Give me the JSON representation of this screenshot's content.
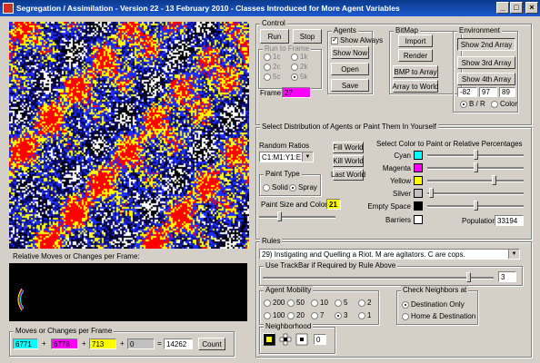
{
  "window": {
    "title": "Segregation / Assimilation - Version 22 - 13 February 2010 - Classes Introduced for More Agent Variables",
    "minimize": "_",
    "maximize": "□",
    "close": "×"
  },
  "left": {
    "moves_chart_label": "Relative Moves or Changes per Frame:",
    "moves_group_title": "Moves or Changes per Frame",
    "counts": [
      "6771",
      "6778",
      "713",
      "0"
    ],
    "plus": "+",
    "equals": "=",
    "total": "14262",
    "count_button": "Count",
    "colors": {
      "cyan": "#00ffff",
      "magenta": "#ff00ff",
      "yellow": "#ffff00",
      "silver": "#c0c0c0"
    }
  },
  "control": {
    "title": "Control",
    "run": "Run",
    "stop": "Stop",
    "run_to_frame_title": "Run to Frame",
    "run_options": [
      "1c",
      "2c",
      "5c",
      "1k",
      "2k",
      "5k"
    ],
    "frame_label": "Frame #",
    "frame_value": "27",
    "agents_title": "Agents",
    "show_always": "Show Always",
    "show_now": "Show Now",
    "open": "Open",
    "save": "Save",
    "bitmap_title": "BitMap",
    "import": "Import",
    "render": "Render",
    "bmp_to_array": "BMP to Array",
    "array_to_world": "Array to World",
    "environment_title": "Environment",
    "show_2nd": "Show 2nd Array",
    "show_3rd": "Show 3rd Array",
    "show_4th": "Show 4th Array",
    "env_values": [
      "-82",
      "97",
      "89"
    ],
    "bw": "B / R",
    "color": "Color"
  },
  "distribution": {
    "title": "Select Distribution of Agents or Paint Them In Yourself",
    "random_ratios_label": "Random Ratios",
    "ratio_selected": "C1:M1:Y1:E1",
    "fill_world": "Fill World",
    "kill_world": "Kill World",
    "last_world": "Last World",
    "paint_type_title": "Paint Type",
    "solid": "Solid",
    "spray": "Spray",
    "paint_size_label": "Paint Size and Color",
    "paint_size_value": "21",
    "paint_size_level": 0.25,
    "select_color_label": "Select Color to Paint or Relative Percentages",
    "colors": [
      {
        "name": "Cyan",
        "hex": "#00ffff",
        "level": 0.5
      },
      {
        "name": "Magenta",
        "hex": "#ff00ff",
        "level": 0.5
      },
      {
        "name": "Yellow",
        "hex": "#ffff00",
        "level": 0.7
      },
      {
        "name": "Silver",
        "hex": "#c0c0c0",
        "level": 0.02
      },
      {
        "name": "Empty Space",
        "hex": "#000000",
        "level": 0.5
      },
      {
        "name": "Barriers",
        "hex": "#ffffff",
        "level": null
      }
    ],
    "population_label": "Population",
    "population_value": "33194"
  },
  "rules": {
    "title": "Rules",
    "rule_selected": "29) Instigating and Quelling a Riot.  M are agitators.  C are cops.",
    "trackbar_title": "Use TrackBar if Required by Rule Above",
    "trackbar_value": "3",
    "trackbar_level": 0.9,
    "mobility_title": "Agent Mobility",
    "mobility_options": [
      "200",
      "50",
      "10",
      "5",
      "2",
      "100",
      "20",
      "7",
      "3",
      "1"
    ],
    "mobility_selected": "3",
    "neighbors_title": "Check Neighbors at",
    "destination_only": "Destination Only",
    "home_destination": "Home & Destination",
    "neighborhood_title": "Neighborhood",
    "neighborhood_value": "0"
  }
}
